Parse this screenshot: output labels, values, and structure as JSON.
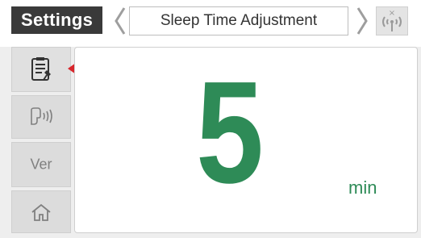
{
  "header": {
    "app_title": "Settings",
    "page_title": "Sleep Time Adjustment",
    "network_icon": "no-signal-antenna-icon"
  },
  "sidebar": {
    "items": [
      {
        "icon": "settings-clipboard-icon",
        "active": true
      },
      {
        "icon": "voice-speaker-icon"
      },
      {
        "label": "Ver"
      },
      {
        "icon": "home-icon"
      }
    ]
  },
  "main": {
    "value": "5",
    "unit": "min"
  },
  "colors": {
    "accent": "#2e8b57",
    "pointer": "#d8262c",
    "header_dark": "#3a3a3a"
  }
}
